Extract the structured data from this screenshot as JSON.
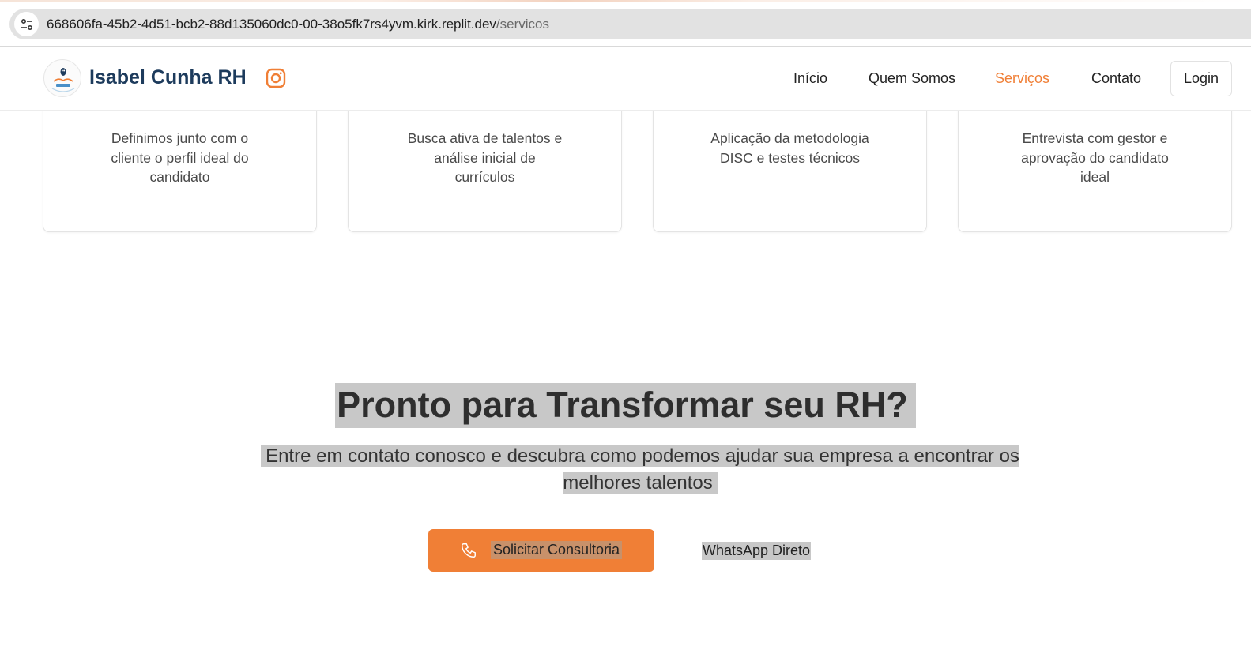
{
  "browser": {
    "url_host": "668606fa-45b2-4d51-bcb2-88d135060dc0-00-38o5fk7rs4yvm.kirk.replit.dev",
    "url_path": "/servicos",
    "site_info_icon": "tune-icon"
  },
  "header": {
    "brand": "Isabel Cunha RH",
    "logo_icon": "owl-logo",
    "social_icon": "instagram-icon",
    "nav": [
      "Início",
      "Quem Somos",
      "Serviços",
      "Contato"
    ],
    "active_nav": "Serviços",
    "login_label": "Login"
  },
  "steps": [
    {
      "text": "Definimos junto com o cliente o perfil ideal do candidato"
    },
    {
      "text": "Busca ativa de talentos e análise inicial de currículos"
    },
    {
      "text": "Aplicação da metodologia DISC e testes técnicos"
    },
    {
      "text": "Entrevista com gestor e aprovação do candidato ideal"
    }
  ],
  "cta": {
    "title": "Pronto para Transformar seu RH?",
    "subtitle": "Entre em contato conosco e descubra como podemos ajudar sua empresa a encontrar os melhores talentos",
    "primary_button": "Solicitar Consultoria",
    "secondary_button": "WhatsApp Direto",
    "primary_icon": "phone-icon"
  },
  "colors": {
    "accent": "#f07f36",
    "brand_text": "#1d3b5c"
  }
}
